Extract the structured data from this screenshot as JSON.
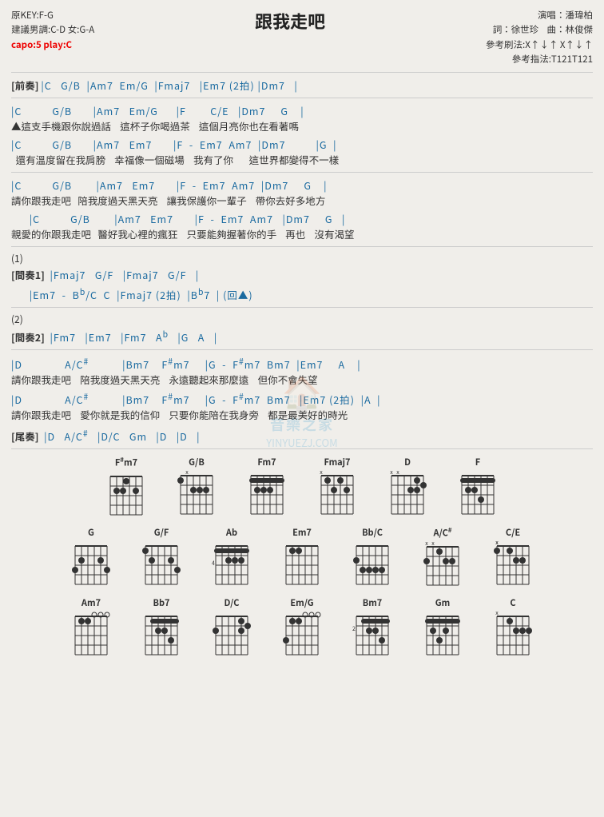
{
  "title": "跟我走吧",
  "meta": {
    "original_key": "原KEY:F-G",
    "suggested_key": "建議男調:C-D 女:G-A",
    "capo": "capo:5 play:C",
    "performer": "演唱：潘瑋柏",
    "lyricist": "詞：徐世珍",
    "composer": "曲：林俊傑",
    "strumming": "參考刷法:X↑↓↑ X↑↓↑",
    "fingering": "參考指法:T121T121"
  },
  "intro_chords": "|C   G/B  |Am7  Em/G  |Fmaj7   |Em7 (2拍) |Dm7   |",
  "sections": [
    {
      "label": "",
      "chords": "|C          G/B       |Am7   Em/G      |F        C/E   |Dm7     G    |",
      "lyrics": "▲這支手機跟你說過話    這杯子你喝過茶    這個月亮你也在看著嗎"
    },
    {
      "label": "",
      "chords": "|C          G/B       |Am7   Em7       |F  -  Em7  Am7  |Dm7          |G  |",
      "lyrics": "  還有溫度留在我肩膀    幸福像一個磁場    我有了你       這世界都變得不一樣"
    },
    {
      "label": "",
      "chords": "|C          G/B        |Am7   Em7       |F  -  Em7  Am7  |Dm7     G    |",
      "lyrics": "請你跟我走吧   陪我度過天黑天亮    讓我保護你一輩子    帶你去好多地方"
    },
    {
      "label": "",
      "chords": "   |C          G/B        |Am7   Em7       |F  -  Em7  Am7   |Dm7     G   |",
      "lyrics": "親愛的你跟我走吧   醫好我心裡的瘋狂    只要能夠握著你的手    再也    沒有渴望"
    },
    {
      "label": "(1)",
      "chords": "",
      "lyrics": ""
    },
    {
      "label": "[間奏1]",
      "chords": "|Fmaj7   G/F   |Fmaj7   G/F   |",
      "lyrics": ""
    },
    {
      "label": "",
      "chords": "   |Em7   -   B♭/C   C   |Fmaj7 (2拍)   |B♭7  | (回▲)",
      "lyrics": ""
    },
    {
      "label": "(2)",
      "chords": "",
      "lyrics": ""
    },
    {
      "label": "[間奏2]",
      "chords": "|Fm7   |Em7   |Fm7   A♭   |G   A   |",
      "lyrics": ""
    },
    {
      "label": "",
      "chords": "|D              A/C#           |Bm7    F#m7     |G  -  F#m7  Bm7  |Em7     A    |",
      "lyrics": "請你跟我走吧    陪我度過天黑天亮    永遠聽起來那麼遠    但你不會失望"
    },
    {
      "label": "",
      "chords": "|D              A/C#           |Bm7    F#m7     |G  -  F#m7  Bm7   |Em7 (2拍)  |A  |",
      "lyrics": "請你跟我走吧    愛你就是我的信仰    只要你能陪在我身旁    都是最美好的時光"
    },
    {
      "label": "[尾奏]",
      "chords": "|D   A/C#   |D/C   Gm   |D   |D   |",
      "lyrics": ""
    }
  ],
  "chord_diagrams": {
    "row1": [
      {
        "name": "F#m7",
        "fret_indicator": ""
      },
      {
        "name": "G/B",
        "fret_indicator": ""
      },
      {
        "name": "Fm7",
        "fret_indicator": ""
      },
      {
        "name": "Fmaj7",
        "fret_indicator": ""
      },
      {
        "name": "D",
        "fret_indicator": ""
      },
      {
        "name": "F",
        "fret_indicator": ""
      }
    ],
    "row2": [
      {
        "name": "G",
        "fret_indicator": ""
      },
      {
        "name": "G/F",
        "fret_indicator": ""
      },
      {
        "name": "Ab",
        "fret_indicator": ""
      },
      {
        "name": "Em7",
        "fret_indicator": ""
      },
      {
        "name": "Bb/C",
        "fret_indicator": ""
      },
      {
        "name": "A/C#",
        "fret_indicator": ""
      },
      {
        "name": "C/E",
        "fret_indicator": ""
      }
    ],
    "row3": [
      {
        "name": "Am7",
        "fret_indicator": ""
      },
      {
        "name": "Bb7",
        "fret_indicator": ""
      },
      {
        "name": "D/C",
        "fret_indicator": ""
      },
      {
        "name": "Em/G",
        "fret_indicator": ""
      },
      {
        "name": "Bm7",
        "fret_indicator": ""
      },
      {
        "name": "Gm",
        "fret_indicator": ""
      },
      {
        "name": "C",
        "fret_indicator": ""
      }
    ]
  },
  "watermark": {
    "text": "音樂之家",
    "url": "YINYUEZJ.COM"
  }
}
